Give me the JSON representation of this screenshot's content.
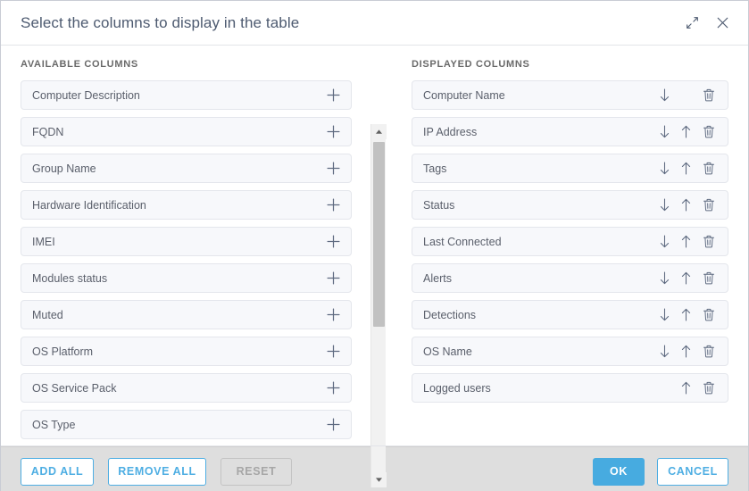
{
  "dialog": {
    "title": "Select the columns to display in the table",
    "expand_icon": "expand-icon",
    "close_icon": "close-icon"
  },
  "available": {
    "heading": "AVAILABLE COLUMNS",
    "add_icon": "plus-icon",
    "items": [
      {
        "label": "Computer Description"
      },
      {
        "label": "FQDN"
      },
      {
        "label": "Group Name"
      },
      {
        "label": "Hardware Identification"
      },
      {
        "label": "IMEI"
      },
      {
        "label": "Modules status"
      },
      {
        "label": "Muted"
      },
      {
        "label": "OS Platform"
      },
      {
        "label": "OS Service Pack"
      },
      {
        "label": "OS Type"
      }
    ]
  },
  "displayed": {
    "heading": "DISPLAYED COLUMNS",
    "move_down_icon": "arrow-down-icon",
    "move_up_icon": "arrow-up-icon",
    "remove_icon": "trash-icon",
    "items": [
      {
        "label": "Computer Name",
        "can_move_down": true,
        "can_move_up": false
      },
      {
        "label": "IP Address",
        "can_move_down": true,
        "can_move_up": true
      },
      {
        "label": "Tags",
        "can_move_down": true,
        "can_move_up": true
      },
      {
        "label": "Status",
        "can_move_down": true,
        "can_move_up": true
      },
      {
        "label": "Last Connected",
        "can_move_down": true,
        "can_move_up": true
      },
      {
        "label": "Alerts",
        "can_move_down": true,
        "can_move_up": true
      },
      {
        "label": "Detections",
        "can_move_down": true,
        "can_move_up": true
      },
      {
        "label": "OS Name",
        "can_move_down": true,
        "can_move_up": true
      },
      {
        "label": "Logged users",
        "can_move_down": false,
        "can_move_up": true
      }
    ]
  },
  "scrollbar": {
    "up_icon": "scroll-up-arrow-icon",
    "down_icon": "scroll-down-arrow-icon"
  },
  "footer": {
    "add_all_label": "ADD ALL",
    "remove_all_label": "REMOVE ALL",
    "reset_label": "RESET",
    "reset_disabled": true,
    "ok_label": "OK",
    "cancel_label": "CANCEL"
  },
  "colors": {
    "accent": "#47abe0",
    "title_text": "#4d5a70",
    "item_background": "#f7f8fb",
    "item_border": "#e4e6ec",
    "footer_background": "#dedede"
  }
}
